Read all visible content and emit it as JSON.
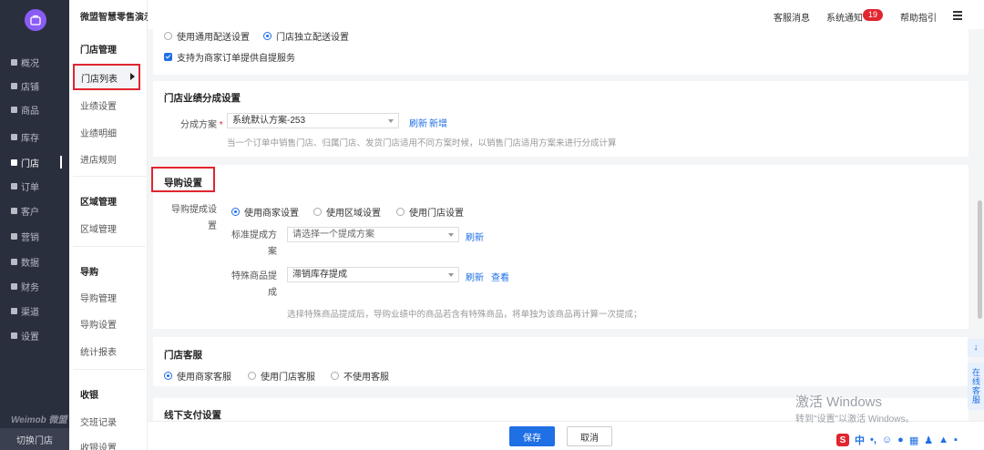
{
  "nav": {
    "items": [
      {
        "label": "概况"
      },
      {
        "label": "店铺"
      },
      {
        "label": "商品"
      },
      {
        "label": "库存"
      },
      {
        "label": "门店"
      },
      {
        "label": "订单"
      },
      {
        "label": "客户"
      },
      {
        "label": "营销"
      },
      {
        "label": "数据"
      },
      {
        "label": "财务"
      },
      {
        "label": "渠道"
      },
      {
        "label": "设置"
      }
    ],
    "brand": "Weimob 微盟",
    "switch_store": "切换门店"
  },
  "header": {
    "store_name": "微盟智慧零售演示账号",
    "customer_msg": "客服消息",
    "system_notice": "系统通知",
    "notice_count": "19",
    "help": "帮助指引"
  },
  "subnav": {
    "groups": {
      "store_mgmt": "门店管理",
      "area_mgmt": "区域管理",
      "guide": "导购",
      "cashier": "收银"
    },
    "items": {
      "store_list": "门店列表",
      "perf_settings": "业绩设置",
      "perf_detail": "业绩明细",
      "entry_rules": "进店规则",
      "area_manage": "区域管理",
      "guide_manage": "导购管理",
      "guide_settings": "导购设置",
      "stats_report": "统计报表",
      "shift_records": "交班记录",
      "cashier_settings": "收银设置"
    }
  },
  "delivery": {
    "opt_general": "使用通用配送设置",
    "opt_store": "门店独立配送设置",
    "self_pickup": "支持为商家订单提供自提服务"
  },
  "perf_split": {
    "title": "门店业绩分成设置",
    "label": "分成方案",
    "required_mark": "*",
    "select_value": "系统默认方案-253",
    "refresh": "刷新",
    "add": "新增",
    "hint": "当一个订单中销售门店、归属门店、发货门店适用不同方案时候，以销售门店适用方案来进行分成计算"
  },
  "guide_settings": {
    "title": "导购设置",
    "commission_label": "导购提成设置",
    "opt_merchant": "使用商家设置",
    "opt_area": "使用区域设置",
    "opt_store": "使用门店设置",
    "std_label": "标准提成方案",
    "std_placeholder": "请选择一个提成方案",
    "std_refresh": "刷新",
    "special_label": "特殊商品提成",
    "special_value": "滞销库存提成",
    "special_refresh": "刷新",
    "special_view": "查看",
    "hint": "选择特殊商品提成后，导购业绩中的商品若含有特殊商品，将单独为该商品再计算一次提成；"
  },
  "store_service": {
    "title": "门店客服",
    "opt_merchant": "使用商家客服",
    "opt_store": "使用门店客服",
    "opt_none": "不使用客服"
  },
  "offline_pay": {
    "title": "线下支付设置"
  },
  "actions": {
    "save": "保存",
    "cancel": "取消"
  },
  "float": {
    "download": "↓",
    "online_service": "在线客服"
  },
  "watermark": {
    "line1": "激活 Windows",
    "line2": "转到\"设置\"以激活 Windows。"
  },
  "tray": {
    "ime": "S",
    "lang": "中"
  }
}
